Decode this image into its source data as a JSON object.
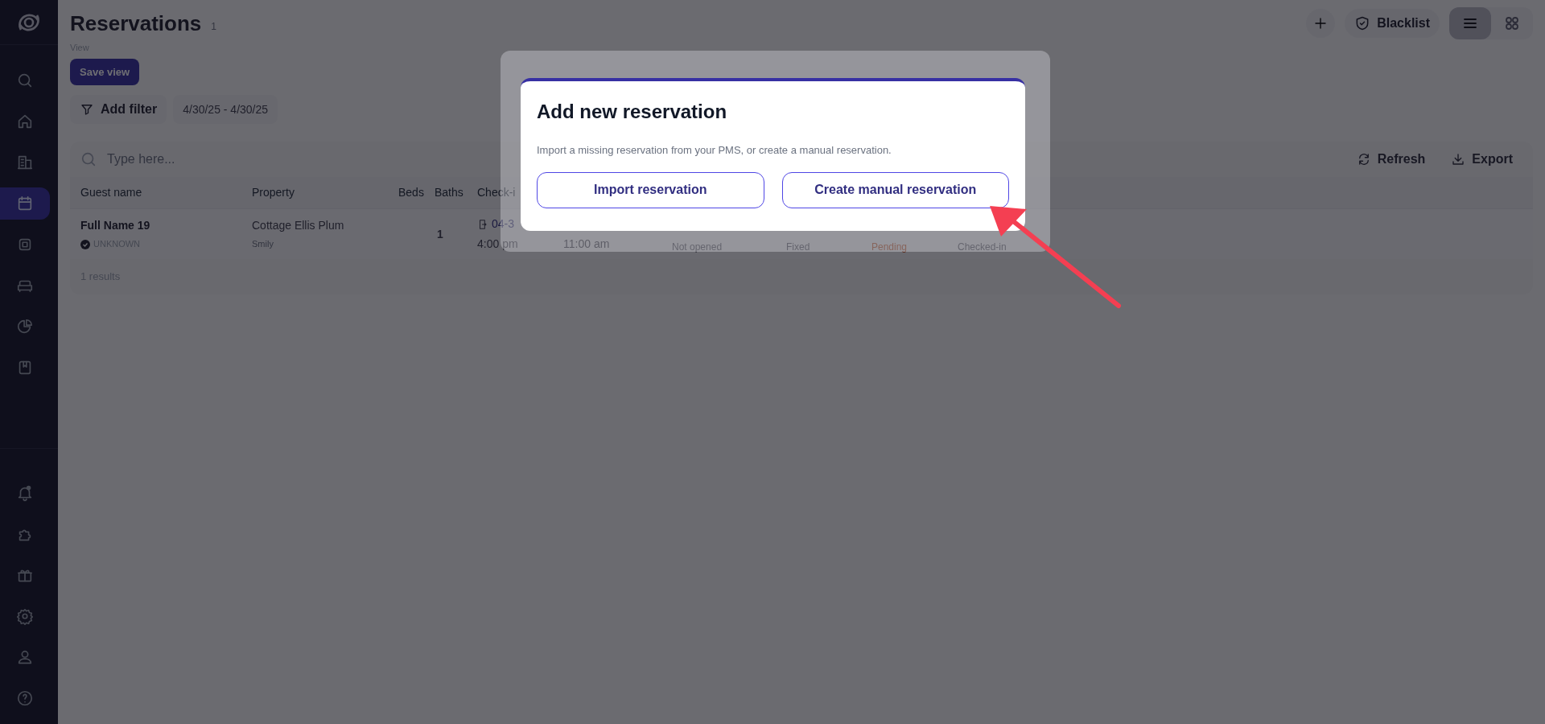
{
  "sidebar": {
    "items": [
      {
        "selected": false
      },
      {
        "selected": false
      },
      {
        "selected": false
      },
      {
        "selected": true
      },
      {
        "selected": false
      },
      {
        "selected": false
      },
      {
        "selected": false
      },
      {
        "selected": false
      }
    ],
    "bottom_items": [
      {
        "selected": false
      },
      {
        "selected": false
      },
      {
        "selected": false
      },
      {
        "selected": false
      },
      {
        "selected": false
      },
      {
        "selected": false
      }
    ]
  },
  "header": {
    "title": "Reservations",
    "count": "1",
    "blacklist": "Blacklist",
    "view_toggle": [
      {
        "selected": true
      },
      {
        "selected": false
      }
    ]
  },
  "view": {
    "label": "View",
    "save_button": "Save view"
  },
  "filters": {
    "add_filter": "Add filter",
    "date_range": "4/30/25 - 4/30/25"
  },
  "search": {
    "placeholder": "Type here...",
    "refresh": "Refresh",
    "export": "Export"
  },
  "table": {
    "columns": [
      "Guest name",
      "Property",
      "Beds",
      "Baths",
      "Check-i"
    ],
    "rows": [
      {
        "guest_name": "Full Name 19",
        "guest_status": "UNKNOWN",
        "property": "Cottage Ellis Plum",
        "property_source": "Smily",
        "baths": "1",
        "check_in_date": "04-3",
        "check_in_time": "4:00 pm",
        "cells": [
          {
            "text": "11:00 am",
            "kind": "time"
          },
          {
            "text": "Not opened",
            "kind": "status"
          },
          {
            "text": "Fixed",
            "kind": "status"
          },
          {
            "text": "Pending",
            "kind": "warning"
          },
          {
            "text": "Checked-in",
            "kind": "status"
          }
        ]
      }
    ],
    "results": "1 results"
  },
  "modal": {
    "title": "Add new reservation",
    "description": "Import a missing reservation from your PMS, or create a manual reservation.",
    "buttons": [
      "Import reservation",
      "Create manual reservation"
    ]
  }
}
